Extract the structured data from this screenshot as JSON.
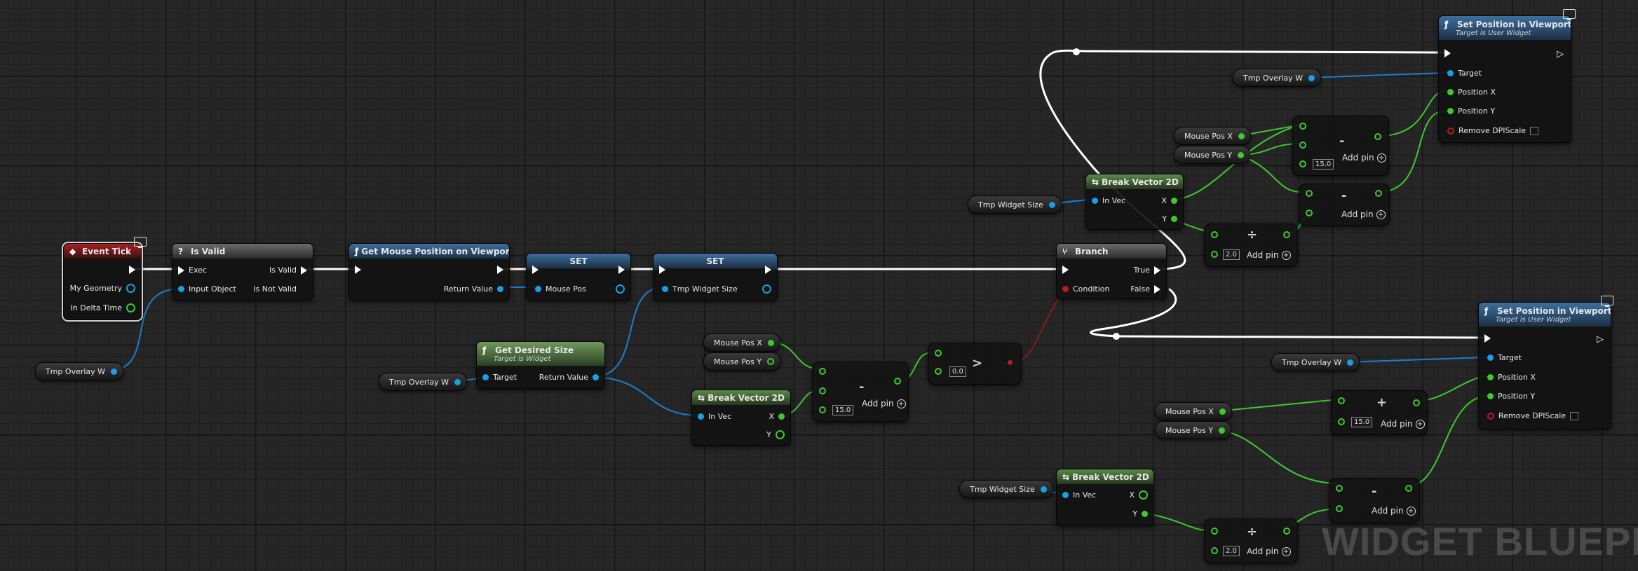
{
  "watermark": "WIDGET BLUEPRINT",
  "colors": {
    "exec": "#ffffff",
    "object_pin": "#1b9ee8",
    "vector_pin": "#3fc92f",
    "bool_pin": "#b81d1d",
    "branch_wire": "#8c1a1a"
  },
  "event_tick": {
    "title": "Event Tick",
    "my_geometry": "My Geometry",
    "in_delta_time": "In Delta Time"
  },
  "is_valid": {
    "title": "Is Valid",
    "exec": "Exec",
    "is_valid": "Is Valid",
    "input_object": "Input Object",
    "is_not_valid": "Is Not Valid"
  },
  "get_mouse_pos": {
    "title": "Get Mouse Position on Viewport",
    "return_value": "Return Value"
  },
  "set_mouse": {
    "title": "SET",
    "pin": "Mouse Pos"
  },
  "set_size": {
    "title": "SET",
    "pin": "Tmp Widget Size"
  },
  "get_desired": {
    "title": "Get Desired Size",
    "subtitle": "Target is Widget",
    "target": "Target",
    "return_value": "Return Value"
  },
  "branch": {
    "title": "Branch",
    "true": "True",
    "condition": "Condition",
    "false": "False"
  },
  "break_vec_main": {
    "title": "Break Vector 2D",
    "in_vec": "In Vec",
    "x": "X",
    "y": "Y"
  },
  "break_vec_top": {
    "title": "Break Vector 2D",
    "in_vec": "In Vec",
    "x": "X",
    "y": "Y"
  },
  "break_vec_bottom": {
    "title": "Break Vector 2D",
    "in_vec": "In Vec",
    "x": "X",
    "y": "Y"
  },
  "set_pos_top": {
    "title": "Set Position in Viewport",
    "subtitle": "Target is User Widget",
    "target": "Target",
    "pos_x": "Position X",
    "pos_y": "Position Y",
    "remove_dpi": "Remove DPIScale"
  },
  "set_pos_bottom": {
    "title": "Set Position in Viewport",
    "subtitle": "Target is User Widget",
    "target": "Target",
    "pos_x": "Position X",
    "pos_y": "Position Y",
    "remove_dpi": "Remove DPIScale"
  },
  "vars": {
    "tmp_overlay_w_1": "Tmp Overlay W",
    "tmp_overlay_w_2": "Tmp Overlay W",
    "tmp_overlay_w_3": "Tmp Overlay W",
    "tmp_overlay_w_4": "Tmp Overlay W",
    "mouse_pos_x_1": "Mouse Pos X",
    "mouse_pos_y_1": "Mouse Pos Y",
    "mouse_pos_x_2": "Mouse Pos X",
    "mouse_pos_y_2": "Mouse Pos Y",
    "mouse_pos_x_3": "Mouse Pos X",
    "mouse_pos_y_3": "Mouse Pos Y",
    "tmp_widget_size_1": "Tmp Widget Size",
    "tmp_widget_size_2": "Tmp Widget Size"
  },
  "math": {
    "sub_main": {
      "op": "-",
      "value": "15.0",
      "add_pin": "Add pin"
    },
    "greater": {
      "op": ">",
      "value": "0.0"
    },
    "sub_top": {
      "op": "-",
      "value": "15.0",
      "add_pin": "Add pin"
    },
    "sub_top2": {
      "op": "-",
      "add_pin": "Add pin"
    },
    "div_top": {
      "op": "÷",
      "value": "2.0",
      "add_pin": "Add pin"
    },
    "add_bottom": {
      "op": "+",
      "value": "15.0",
      "add_pin": "Add pin"
    },
    "sub_bottom": {
      "op": "-",
      "add_pin": "Add pin"
    },
    "div_bottom": {
      "op": "÷",
      "value": "2.0",
      "add_pin": "Add pin"
    }
  }
}
